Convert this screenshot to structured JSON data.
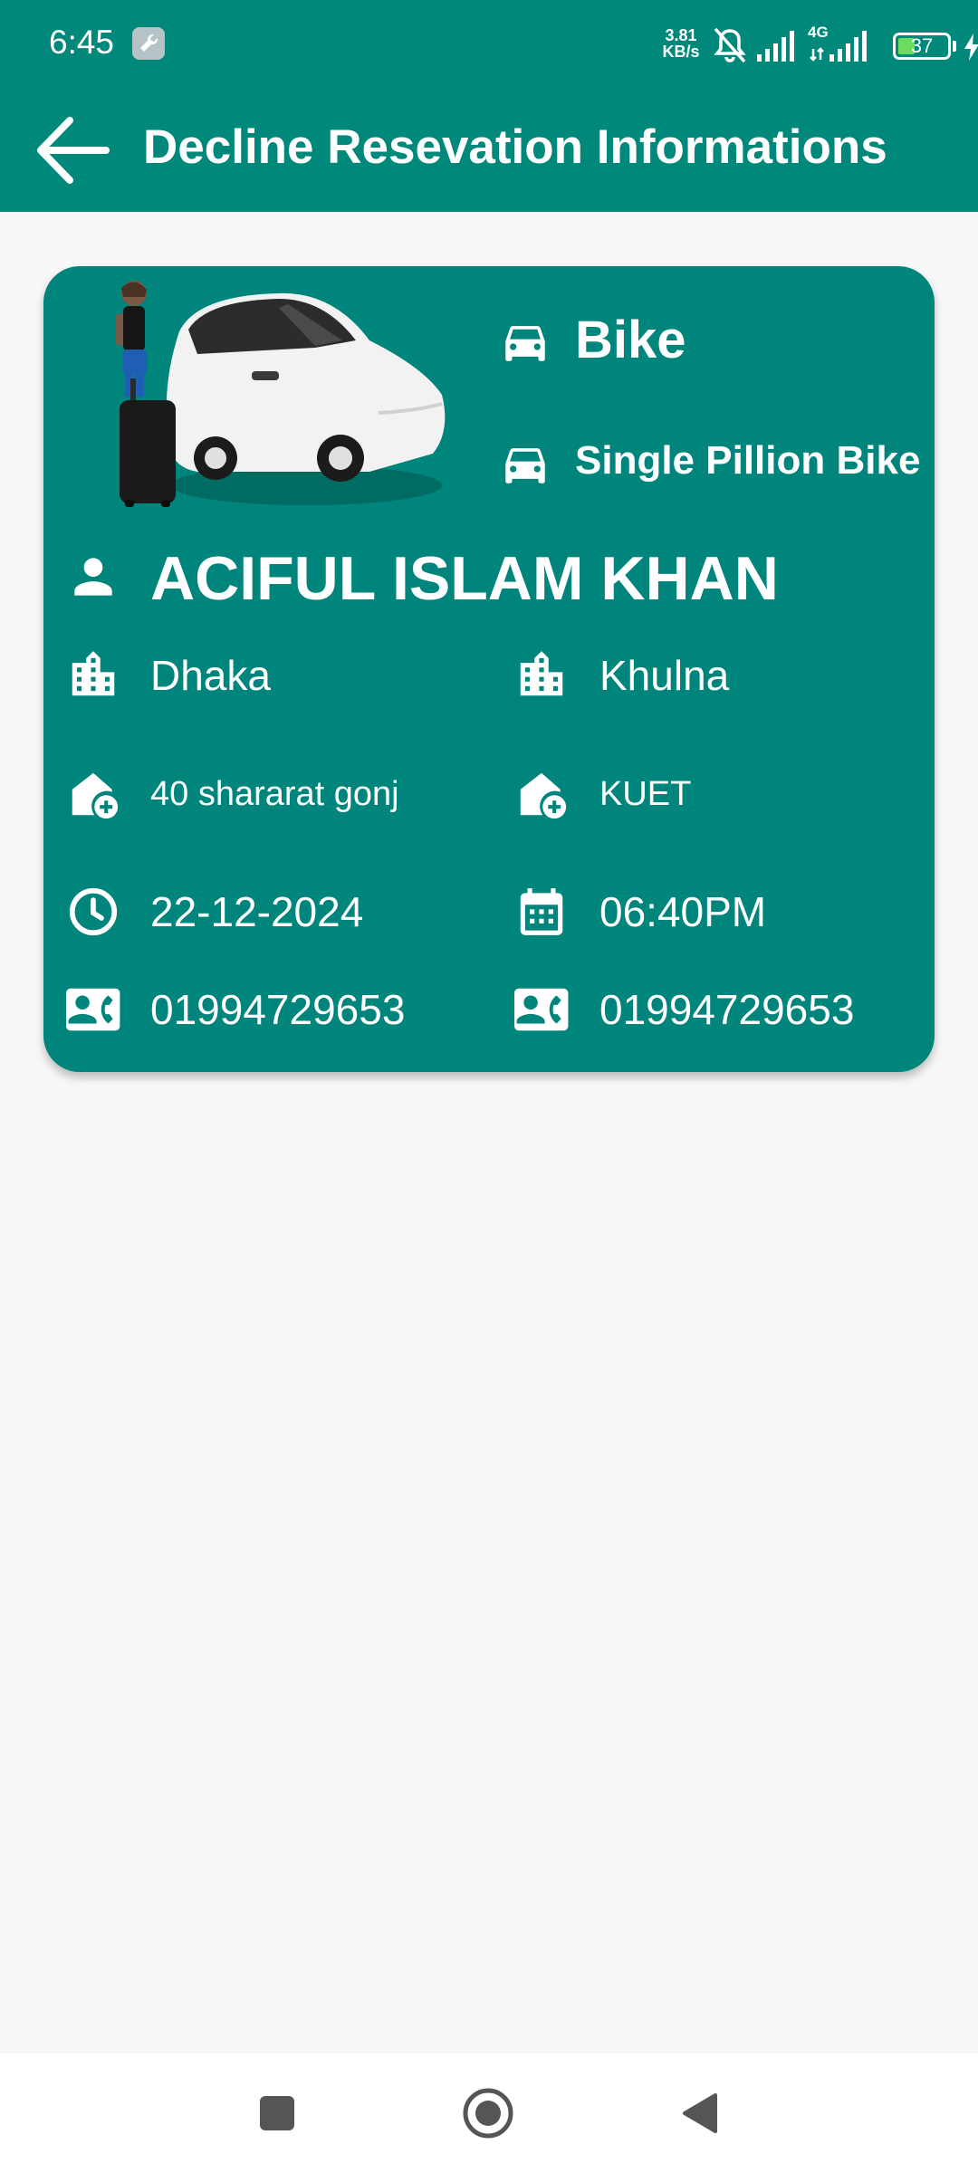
{
  "status_bar": {
    "time": "6:45",
    "net_speed_value": "3.81",
    "net_speed_unit": "KB/s",
    "network_type": "4G",
    "battery_level": "37"
  },
  "app_bar": {
    "title": "Decline Resevation Informations"
  },
  "reservation": {
    "vehicle_type": "Bike",
    "vehicle_subtype": "Single Pillion Bike",
    "passenger_name": "ACIFUL ISLAM KHAN",
    "pickup_city": "Dhaka",
    "dropoff_city": "Khulna",
    "pickup_address": "40 shararat gonj",
    "dropoff_address": "KUET",
    "date": "22-12-2024",
    "time": "06:40PM",
    "passenger_phone": "01994729653",
    "driver_phone": "01994729653"
  },
  "colors": {
    "primary": "#00897b",
    "card": "#00857c",
    "background": "#f8f8f8"
  },
  "icons": {
    "back": "arrow-back-icon",
    "vehicle": "car-icon",
    "person": "person-icon",
    "city": "city-icon",
    "address": "home-add-icon",
    "clock": "clock-icon",
    "calendar": "calendar-icon",
    "phone": "contact-phone-icon"
  }
}
